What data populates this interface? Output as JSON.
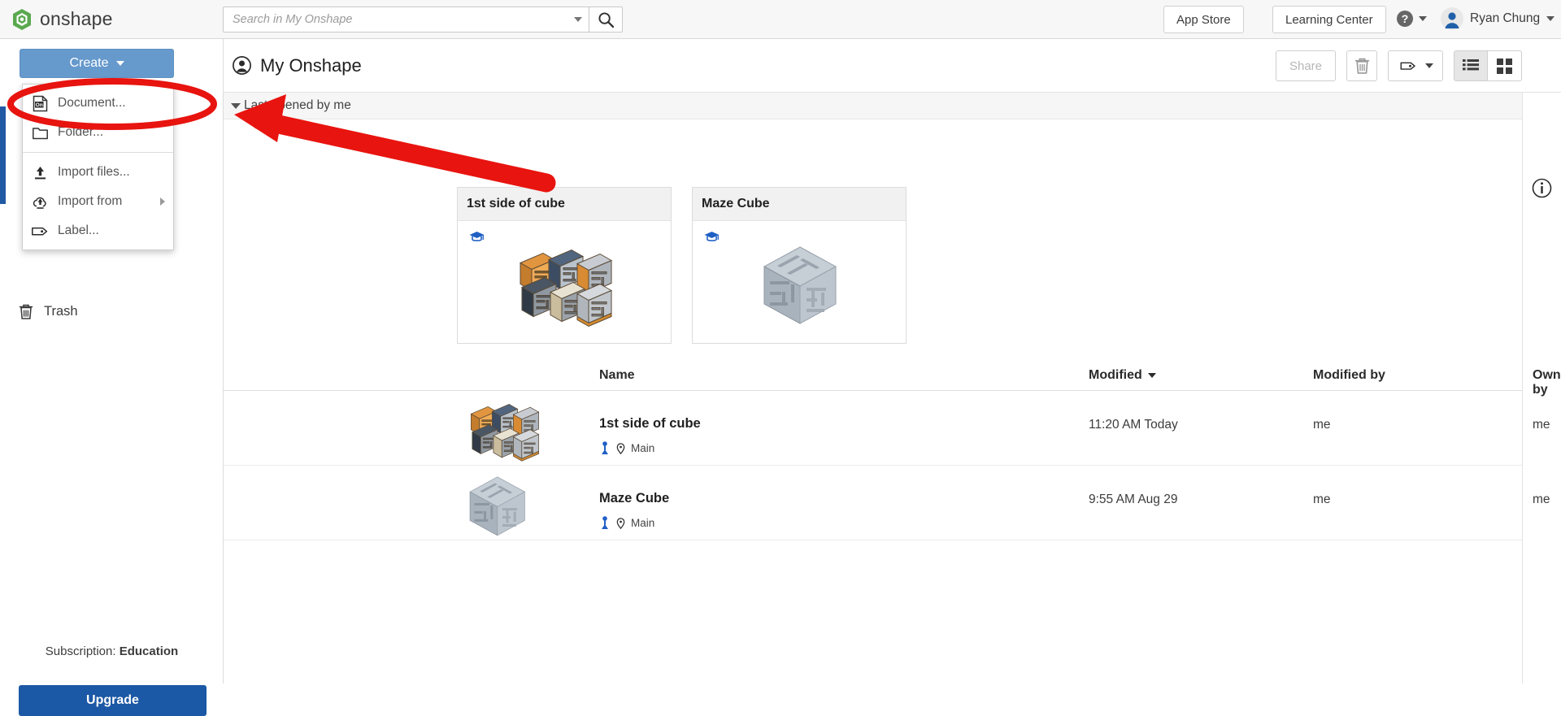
{
  "brand": {
    "name": "onshape",
    "logo_icon": "onshape-logo-icon"
  },
  "search": {
    "placeholder": "Search in My Onshape",
    "value": "",
    "dropdown_icon": "chevron-down-icon",
    "button_icon": "search-icon"
  },
  "topbar": {
    "app_store_label": "App Store",
    "learning_center_label": "Learning Center",
    "help_icon": "question-circle-icon",
    "help_caret_icon": "chevron-down-icon",
    "avatar_icon": "user-avatar-icon",
    "user_name": "Ryan Chung",
    "user_caret_icon": "chevron-down-icon"
  },
  "sidebar": {
    "create_label": "Create",
    "create_caret_icon": "chevron-down-icon",
    "trash_label": "Trash",
    "trash_icon": "trash-icon",
    "subscription_prefix": "Subscription: ",
    "subscription_plan": "Education",
    "upgrade_label": "Upgrade"
  },
  "create_menu": {
    "items": [
      {
        "label": "Document...",
        "icon": "onshape-document-icon",
        "has_submenu": false
      },
      {
        "label": "Folder...",
        "icon": "folder-icon",
        "has_submenu": false
      },
      {
        "label": "Import files...",
        "icon": "upload-icon",
        "has_submenu": false
      },
      {
        "label": "Import from",
        "icon": "cloud-upload-icon",
        "has_submenu": true
      },
      {
        "label": "Label...",
        "icon": "label-tag-icon",
        "has_submenu": false
      }
    ]
  },
  "page": {
    "title": "My Onshape",
    "title_icon": "user-circle-icon"
  },
  "header_tools": {
    "share_label": "Share",
    "share_enabled": false,
    "delete_icon": "trash-icon",
    "label_icon": "label-tag-icon",
    "label_caret_icon": "chevron-down-icon",
    "view_list_icon": "list-view-icon",
    "view_grid_icon": "grid-view-icon",
    "active_view": "list",
    "info_icon": "info-circle-icon"
  },
  "recent": {
    "caret_icon": "chevron-down-icon",
    "label": "Last opened by me",
    "cards": [
      {
        "title": "1st side of cube",
        "badge_icon": "graduation-cap-icon",
        "thumb": "maze-panels-thumbnail"
      },
      {
        "title": "Maze Cube",
        "badge_icon": "graduation-cap-icon",
        "thumb": "maze-cube-thumbnail"
      }
    ]
  },
  "table": {
    "columns": [
      {
        "key": "name",
        "label": "Name",
        "sorted": false
      },
      {
        "key": "modified",
        "label": "Modified",
        "sorted": true,
        "sort_icon": "caret-down-icon"
      },
      {
        "key": "modified_by",
        "label": "Modified by",
        "sorted": false
      },
      {
        "key": "owned_by",
        "label": "Owned by",
        "sorted": false
      }
    ],
    "rows": [
      {
        "name": "1st side of cube",
        "branch": "Main",
        "branch_icon": "branch-icon",
        "pin_icon": "location-pin-icon",
        "badge_icon": "graduation-cap-icon",
        "thumb": "maze-panels-thumbnail",
        "modified": "11:20 AM Today",
        "modified_by": "me",
        "owned_by": "me"
      },
      {
        "name": "Maze Cube",
        "branch": "Main",
        "branch_icon": "branch-icon",
        "pin_icon": "location-pin-icon",
        "badge_icon": "graduation-cap-icon",
        "thumb": "maze-cube-thumbnail",
        "modified": "9:55 AM Aug 29",
        "modified_by": "me",
        "owned_by": "me"
      }
    ]
  },
  "annotations": {
    "highlight_color": "#e8140f",
    "ellipse_target": "Document... menu item",
    "arrow_target": "Last opened by me section"
  },
  "colors": {
    "brand_green": "#5aa84f",
    "create_blue": "#6699cc",
    "upgrade_blue": "#1b58a5",
    "selection_blue": "#2159a5",
    "annotation_red": "#e8140f"
  }
}
